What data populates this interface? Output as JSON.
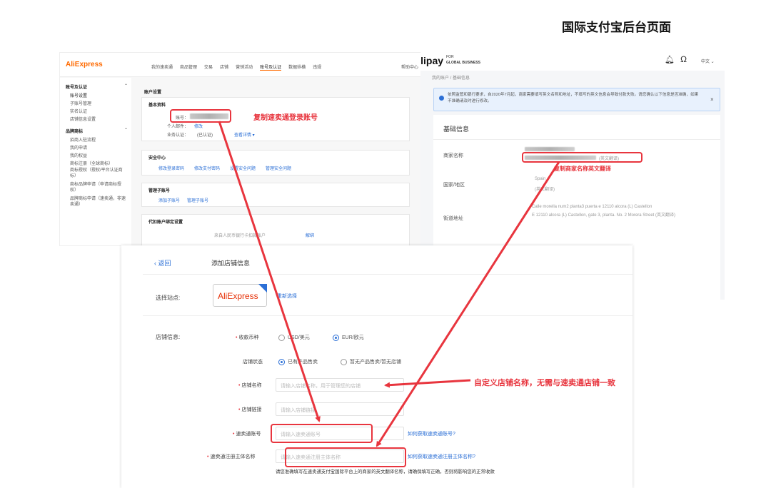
{
  "page_title": "国际支付宝后台页面",
  "aliexpress_panel": {
    "logo": "AliExpress",
    "nav": [
      "我的速卖通",
      "商品管理",
      "交易",
      "店铺",
      "营销活动",
      "账号及认证",
      "数据纵横",
      "违规"
    ],
    "nav_right": "帮助中心",
    "sidebar": {
      "groups": [
        {
          "title": "账号及认证",
          "items": [
            "账号设置",
            "子账号管理",
            "实名认证",
            "店铺信息设置"
          ]
        },
        {
          "title": "品牌商标",
          "items": [
            "招商入驻流程",
            "我的申请",
            "我的权益",
            "商标注册（全球商标）",
            "商标授权（授权/平台认证商标）",
            "商标品牌申请（申请商标授权）",
            "品牌商标申请（速卖通，非速卖通）"
          ]
        }
      ]
    },
    "section_title": "账户设置",
    "basic_info": "基本资料",
    "account_label": "账号：",
    "field2_label": "个人邮件：",
    "field2_link": "修改",
    "field3_label": "业务认证：",
    "field3_value": "(已认证)",
    "field3_link": "查看详情 ▾",
    "security_title": "安全中心",
    "security_links": [
      "修改登录密码",
      "修改支付密码",
      "设置安全问题",
      "管理安全问题"
    ],
    "sub_title": "管理子账号",
    "sub_links": [
      "添加子账号",
      "管理子账号"
    ],
    "payout_title": "代扣账户绑定设置",
    "payout_row": "来自人民币银行卡扣款账户",
    "payout_link": "解绑"
  },
  "alipay_panel": {
    "logo": "Alipay",
    "logo_sub1": "FOR",
    "logo_sub2": "GLOBAL BUSINESS",
    "lang": "中文",
    "breadcrumb": "我的账户 / 基础信息",
    "notice": "依照监管和银行要求，自2020年7月起，商家需要填写英文名称和地址，不填写的英文信息会导致付款失败。请您确认以下信息是否准确，如果不准确请及时进行修改。",
    "notice_close": "×",
    "basic_title": "基础信息",
    "rows": [
      {
        "label": "商家名称",
        "value_suffix": "(英文翻译)"
      },
      {
        "label": "国家/地区",
        "value": "Spain",
        "value_suffix": "(英文翻译)"
      },
      {
        "label": "街道地址",
        "value": "Calle morella num2 planta3 puerta e 12110 alcora (L) Castellon",
        "value2": "E 12110 alcora (L) Castellon, gate 3, planta. No. 2 Morera Street (英文翻译)"
      }
    ]
  },
  "form_panel": {
    "back": "返回",
    "title": "添加店铺信息",
    "site_label": "选择站点:",
    "site_logo": "AliExpress",
    "reselect": "重新选择",
    "shop_info_label": "店铺信息:",
    "currency_label": "收款币种",
    "currency_options": [
      "USD/美元",
      "EUR/欧元"
    ],
    "currency_selected": 1,
    "status_label": "店铺状态",
    "status_options": [
      "已有产品售卖",
      "暂无产品售卖/暂无店铺"
    ],
    "status_selected": 0,
    "name_label": "店铺名称",
    "name_placeholder": "请输入店铺名称，用于管理您的店铺",
    "url_label": "店铺链接",
    "url_placeholder": "请输入店铺链接",
    "account_label": "速卖通账号",
    "account_placeholder": "请输入速卖通账号",
    "account_help": "如何获取速卖通账号?",
    "entity_label": "速卖通注册主体名称",
    "entity_placeholder": "请输入速卖通注册主体名称",
    "entity_help": "如何获取速卖通注册主体名称?",
    "entity_note": "请您准确填写在速卖通支付宝国际平台上的商家的英文翻译名称，请确保填写正确，否则将影响您的正常收款"
  },
  "annotations": {
    "copy_login": "复制速卖通登录账号",
    "copy_name": "复制商家名称英文翻译",
    "custom_name": "自定义店铺名称，无需与速卖通店铺一致"
  },
  "colors": {
    "accent_red": "#e8353e",
    "link_blue": "#2b6fd6",
    "aliexpress_orange": "#ff6a00"
  }
}
